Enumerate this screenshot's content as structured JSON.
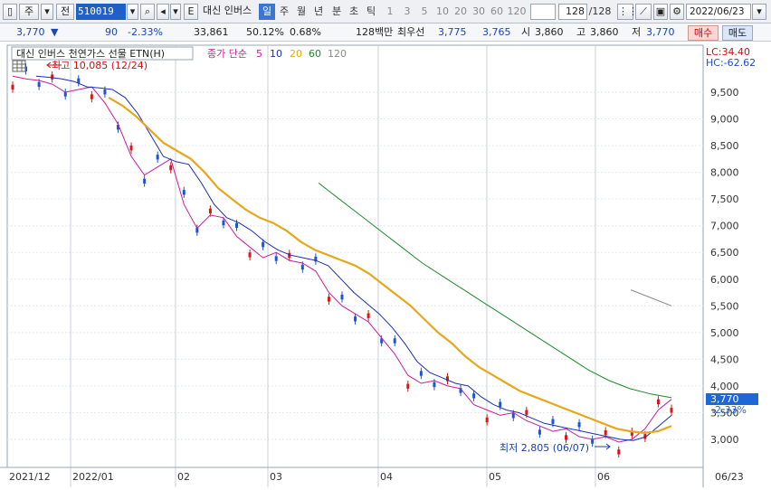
{
  "toolbar": {
    "type_label": "주",
    "prefix_label": "전",
    "stock_code": "510019",
    "e_label": "E",
    "stock_name": "대신 인버스",
    "period_tabs": [
      "일",
      "주",
      "월",
      "년",
      "분",
      "초",
      "틱"
    ],
    "active_period": "일",
    "intervals": [
      "1",
      "3",
      "5",
      "10",
      "20",
      "30",
      "60",
      "120"
    ],
    "count_value": "128",
    "count_total": "/128",
    "date": "2022/06/23"
  },
  "status": {
    "price": "3,770",
    "change_arrow": "▼",
    "change": "90",
    "change_pct": "-2.33%",
    "volume": "33,861",
    "volume_ratio": "50.12%",
    "turnover_ratio": "0.68%",
    "label_128": "128백만",
    "priority_label": "최우선",
    "ask": "3,775",
    "bid": "3,765",
    "open_label": "시",
    "open": "3,860",
    "high_label": "고",
    "high": "3,860",
    "low_label": "저",
    "low": "3,770",
    "buy_label": "매수",
    "sell_label": "매도"
  },
  "chart_header": {
    "title": "대신 인버스 천연가스 선물 ETN(H)",
    "ma_label": "종가 단순",
    "ma_periods": [
      "5",
      "10",
      "20",
      "60",
      "120"
    ],
    "ma_colors": [
      "#c81e9b",
      "#1a2fb3",
      "#e7a71a",
      "#1f8a2c",
      "#8a8a8a"
    ],
    "lc": "LC:34.40",
    "hc": "HC:-62.62"
  },
  "annotations": {
    "high": "최고 10,085 (12/24)",
    "low": "최저 2,805 (06/07)"
  },
  "price_tag": {
    "price": "3,770",
    "change": "-2.33%"
  },
  "chart_data": {
    "type": "line",
    "y_ticks": [
      "9,500",
      "9,000",
      "8,500",
      "8,000",
      "7,500",
      "7,000",
      "6,500",
      "6,000",
      "5,500",
      "5,000",
      "4,500",
      "4,000",
      "3,500",
      "3,000"
    ],
    "x_ticks": [
      "2021/12",
      "2022/01",
      "02",
      "03",
      "04",
      "05",
      "06",
      "06/23"
    ],
    "ylim": [
      2700,
      10200
    ],
    "series": [
      {
        "name": "5",
        "values": [
          9800,
          9750,
          9720,
          9650,
          9500,
          9550,
          9600,
          9300,
          8900,
          8300,
          7950,
          8100,
          8250,
          7400,
          6950,
          7200,
          7150,
          6800,
          6600,
          6400,
          6500,
          6350,
          6300,
          6150,
          5750,
          5500,
          5350,
          5200,
          4900,
          4600,
          4200,
          4050,
          4100,
          4000,
          3950,
          3650,
          3550,
          3450,
          3500,
          3350,
          3250,
          3150,
          3200,
          3050,
          3000,
          3050,
          2950,
          3000,
          3200,
          3550,
          3750
        ]
      },
      {
        "name": "10",
        "values": [
          9800,
          9780,
          9750,
          9700,
          9600,
          9580,
          9550,
          9400,
          9100,
          8700,
          8300,
          8200,
          8150,
          7800,
          7400,
          7150,
          7050,
          6900,
          6700,
          6550,
          6450,
          6400,
          6350,
          6250,
          6000,
          5750,
          5550,
          5350,
          5100,
          4800,
          4450,
          4250,
          4150,
          4050,
          4000,
          3800,
          3650,
          3550,
          3500,
          3400,
          3300,
          3250,
          3200,
          3150,
          3100,
          3050,
          3000,
          2980,
          3050,
          3250,
          3450
        ]
      },
      {
        "name": "20",
        "values": [
          9400,
          9250,
          9050,
          8800,
          8550,
          8400,
          8250,
          8000,
          7700,
          7500,
          7300,
          7150,
          7050,
          6900,
          6700,
          6550,
          6450,
          6350,
          6250,
          6100,
          5900,
          5700,
          5500,
          5250,
          5000,
          4800,
          4550,
          4350,
          4200,
          4050,
          3900,
          3800,
          3700,
          3600,
          3500,
          3400,
          3300,
          3200,
          3150,
          3120,
          3150,
          3250
        ]
      },
      {
        "name": "60",
        "values": [
          7800,
          7500,
          7200,
          6900,
          6600,
          6300,
          6050,
          5800,
          5550,
          5300,
          5050,
          4800,
          4550,
          4300,
          4100,
          3950,
          3850,
          3780
        ]
      },
      {
        "name": "120",
        "values": [
          5800,
          5700,
          5600,
          5500
        ]
      }
    ],
    "high": 10085,
    "low": 2805
  }
}
